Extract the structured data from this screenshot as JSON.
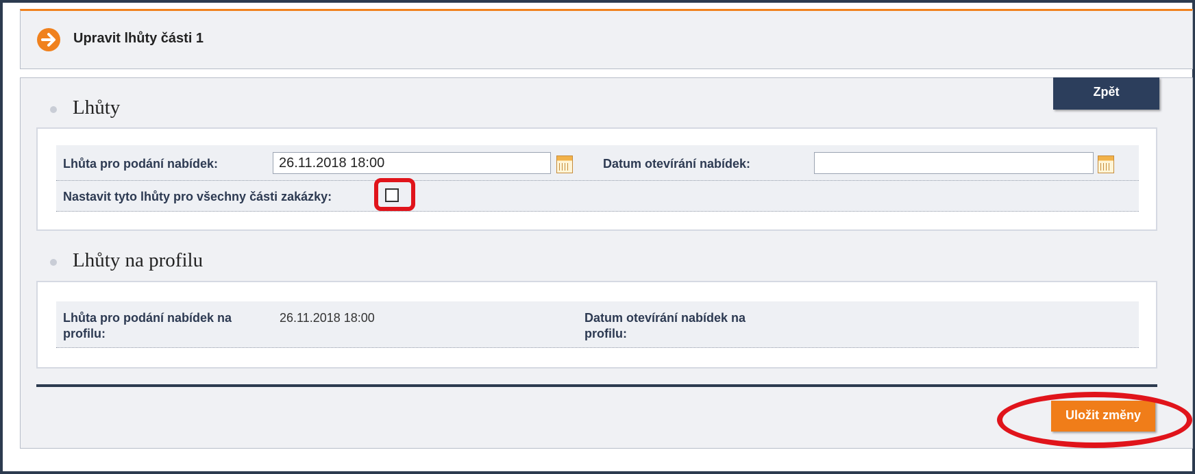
{
  "header": {
    "title": "Upravit lhůty části 1",
    "icon": "arrow-right-circle-icon",
    "accent_color": "#f0811d"
  },
  "toolbar": {
    "back_label": "Zpět"
  },
  "deadlines": {
    "section_title": "Lhůty",
    "submission_label": "Lhůta pro podání nabídek:",
    "submission_value": "26.11.2018 18:00",
    "opening_label": "Datum otevírání nabídek:",
    "opening_value": "",
    "apply_all_label": "Nastavit tyto lhůty pro všechny části zakázky:",
    "apply_all_checked": false
  },
  "profile_deadlines": {
    "section_title": "Lhůty na profilu",
    "submission_label": "Lhůta pro podání nabídek na profilu:",
    "submission_value": "26.11.2018 18:00",
    "opening_label": "Datum otevírání nabídek na profilu:",
    "opening_value": ""
  },
  "footer": {
    "save_label": "Uložit změny"
  },
  "colors": {
    "primary_dark": "#2c3e5c",
    "save_orange": "#f07d19",
    "annotation_red": "#e0141b"
  }
}
